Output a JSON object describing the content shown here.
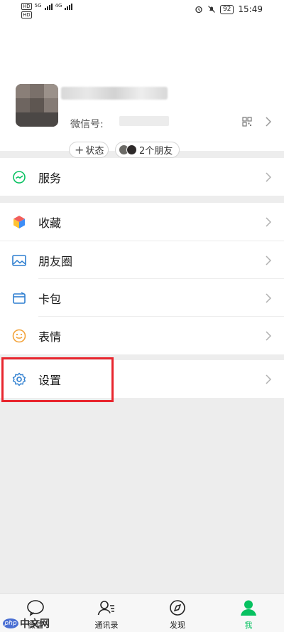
{
  "status_bar": {
    "sim1_tag": "HD",
    "sim2_tag": "HD",
    "net1": "5G",
    "net2": "4G",
    "battery": "92",
    "time": "15:49",
    "icons": [
      "alarm-icon",
      "mute-icon"
    ]
  },
  "profile": {
    "wxid_label": "微信号:",
    "status_button": "状态",
    "friends_button": "2个朋友"
  },
  "menu": {
    "services": "服务",
    "favorites": "收藏",
    "moments": "朋友圈",
    "cards": "卡包",
    "stickers": "表情",
    "settings": "设置"
  },
  "tabbar": {
    "chats": "微信",
    "contacts": "通讯录",
    "discover": "发现",
    "me": "我"
  },
  "watermark": {
    "badge": "php",
    "text": "中文网"
  },
  "colors": {
    "accent": "#07c160",
    "highlight": "#e8262e",
    "background": "#ededed"
  }
}
